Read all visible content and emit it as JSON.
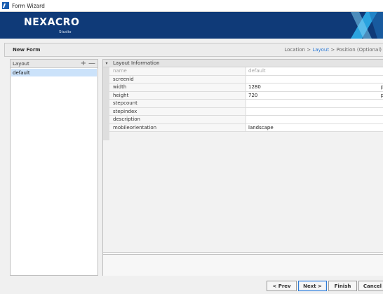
{
  "window": {
    "title": "Form Wizard"
  },
  "banner": {
    "brand": "NEXACRO",
    "sub": "Studio"
  },
  "header": {
    "title": "New Form",
    "breadcrumb": {
      "step1": "Location",
      "sep1": ">",
      "step2": "Layout",
      "sep2": ">",
      "step3": "Position (Optional)"
    }
  },
  "layout_panel": {
    "header": "Layout",
    "add_label": "+",
    "remove_label": "—",
    "items": [
      "default"
    ]
  },
  "property_panel": {
    "section": "Layout Information",
    "toggle_glyph": "▾",
    "rows": [
      {
        "name": "name",
        "value": "default",
        "unit": ""
      },
      {
        "name": "screenid",
        "value": "",
        "unit": ""
      },
      {
        "name": "width",
        "value": "1280",
        "unit": "p"
      },
      {
        "name": "height",
        "value": "720",
        "unit": "p"
      },
      {
        "name": "stepcount",
        "value": "",
        "unit": ""
      },
      {
        "name": "stepindex",
        "value": "",
        "unit": ""
      },
      {
        "name": "description",
        "value": "",
        "unit": ""
      },
      {
        "name": "mobileorientation",
        "value": "landscape",
        "unit": ""
      }
    ]
  },
  "buttons": {
    "prev": "< Prev",
    "next": "Next >",
    "finish": "Finish",
    "cancel": "Cancel"
  },
  "colors": {
    "banner": "#0f3a78",
    "accent": "#2e7bd6",
    "selection": "#cbe2fa"
  }
}
